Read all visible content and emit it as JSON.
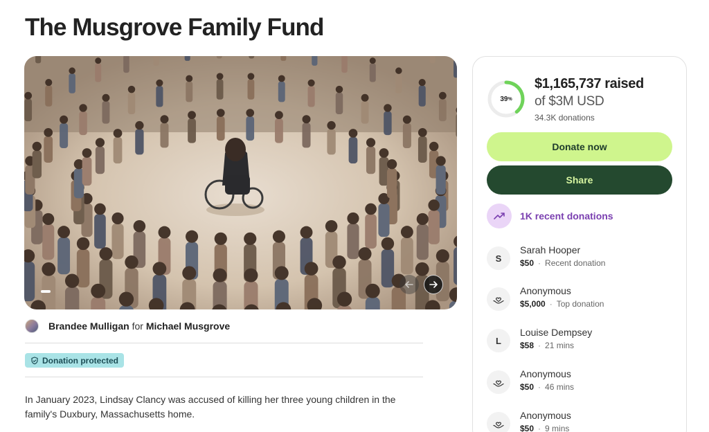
{
  "page_title": "The Musgrove Family Fund",
  "organizer": {
    "name": "Brandee Mulligan",
    "connector": "for",
    "beneficiary": "Michael Musgrove"
  },
  "badge": {
    "label": "Donation protected"
  },
  "story_text": "In January 2023, Lindsay Clancy was accused of killing her three young children in the family's Duxbury, Massachusetts home.",
  "progress": {
    "percent_label": "39",
    "percent_symbol": "%",
    "percent_value": 0.39,
    "raised": "$1,165,737 raised",
    "goal": "of $3M USD",
    "donations_count": "34.3K donations"
  },
  "buttons": {
    "donate": "Donate now",
    "share": "Share"
  },
  "recent_donations": {
    "label": "1K recent donations",
    "icon": "trending-up-icon"
  },
  "donors": [
    {
      "avatar": "S",
      "avatar_type": "letter",
      "name": "Sarah Hooper",
      "amount": "$50",
      "separator": "·",
      "meta": "Recent donation"
    },
    {
      "avatar": "",
      "avatar_type": "hand-heart-icon",
      "name": "Anonymous",
      "amount": "$5,000",
      "separator": "·",
      "meta": "Top donation"
    },
    {
      "avatar": "L",
      "avatar_type": "letter",
      "name": "Louise Dempsey",
      "amount": "$58",
      "separator": "·",
      "meta": "21 mins"
    },
    {
      "avatar": "",
      "avatar_type": "hand-heart-icon",
      "name": "Anonymous",
      "amount": "$50",
      "separator": "·",
      "meta": "46 mins"
    },
    {
      "avatar": "",
      "avatar_type": "hand-heart-icon",
      "name": "Anonymous",
      "amount": "$50",
      "separator": "·",
      "meta": "9 mins"
    }
  ],
  "colors": {
    "donate_button": "#cff58d",
    "share_button": "#24492f",
    "progress_ring": "#6fd35a",
    "recent_accent": "#7a3fb0",
    "badge_bg": "#a9e3e6"
  }
}
